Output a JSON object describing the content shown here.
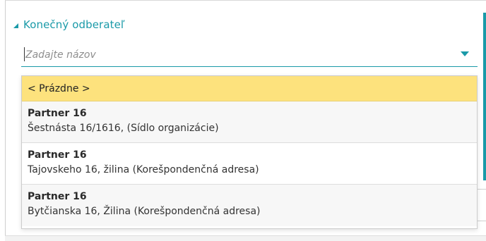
{
  "section": {
    "title": "Konečný odberateľ",
    "collapse_icon": "triangle-collapse-icon"
  },
  "combo": {
    "value": "",
    "placeholder": "Zadajte názov",
    "dropdown_icon": "chevron-down-icon"
  },
  "dropdown": {
    "empty_option": "< Prázdne >",
    "items": [
      {
        "name": "Partner 16",
        "address": "Šestnásta 16/1616, (Sídlo organizácie)"
      },
      {
        "name": "Partner 16",
        "address": "Tajovskeho 16, žilina (Korešpondenčná adresa)"
      },
      {
        "name": "Partner 16",
        "address": "Bytčianska 16, Žilina (Korešpondenčná adresa)"
      }
    ]
  },
  "colors": {
    "accent": "#1a9aa8",
    "highlight": "#fde27d"
  }
}
